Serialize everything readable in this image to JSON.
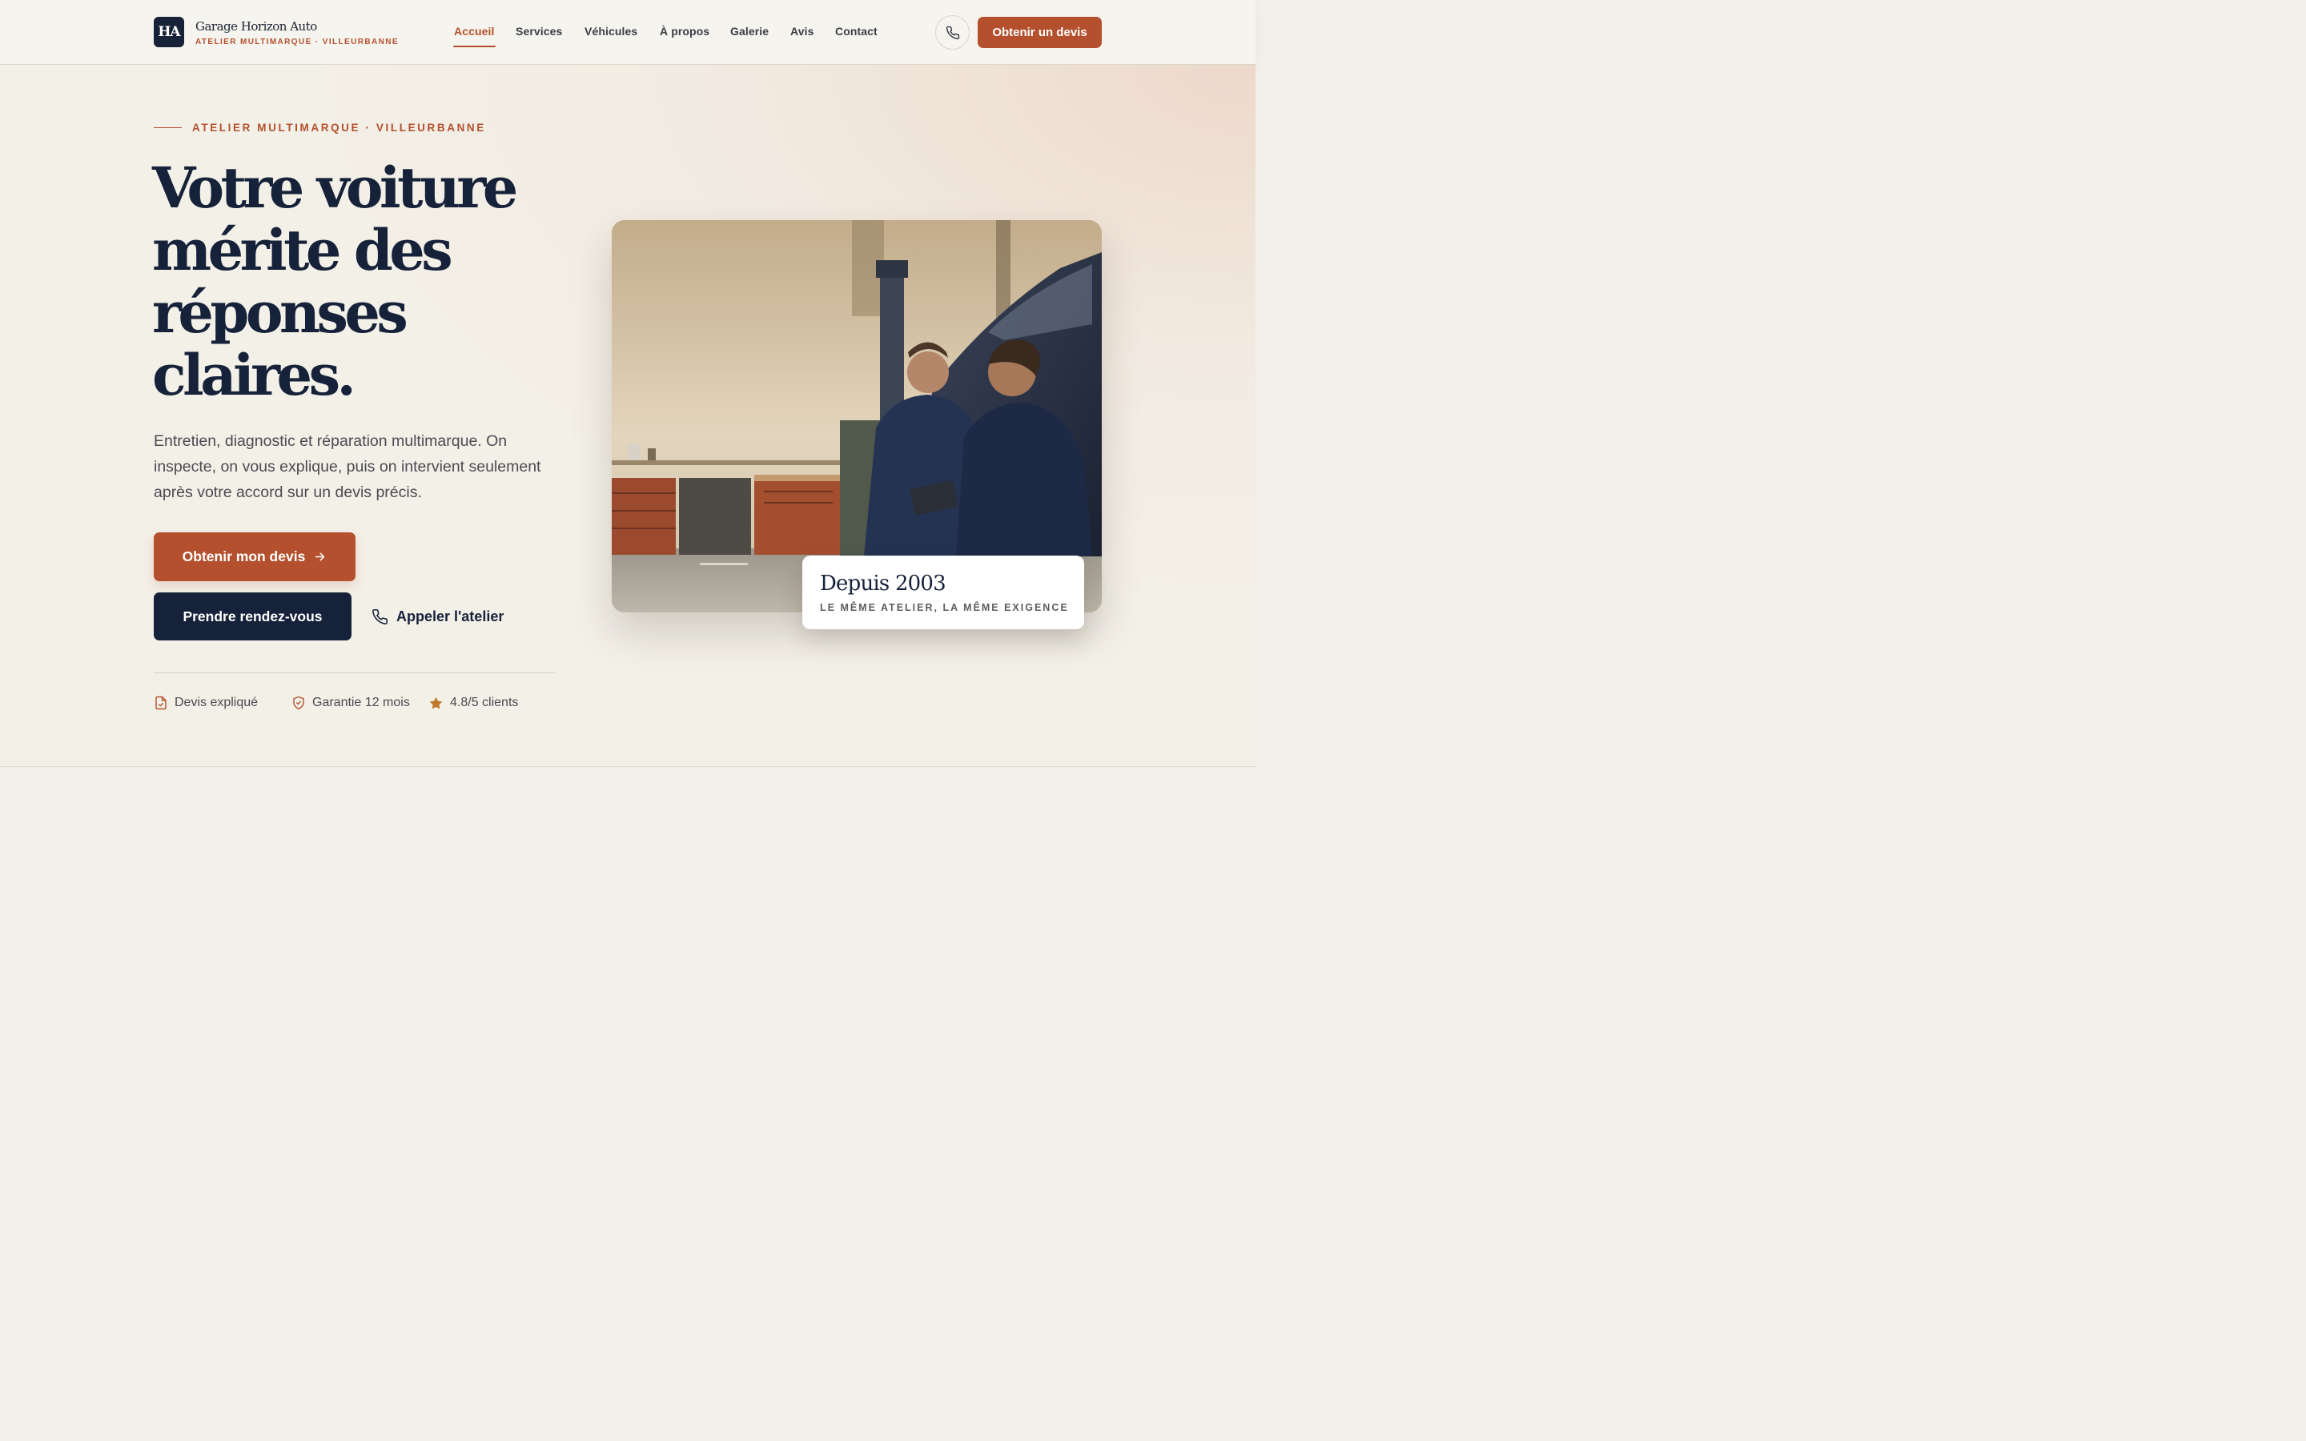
{
  "brand": {
    "logo_initials": "HA",
    "name": "Garage Horizon Auto",
    "tagline": "ATELIER MULTIMARQUE · VILLEURBANNE"
  },
  "nav": {
    "items": [
      {
        "label": "Accueil",
        "active": true
      },
      {
        "label": "Services",
        "active": false
      },
      {
        "label": "Véhicules",
        "active": false
      },
      {
        "label": "À propos",
        "active": false
      },
      {
        "label": "Galerie",
        "active": false
      },
      {
        "label": "Avis",
        "active": false
      },
      {
        "label": "Contact",
        "active": false
      }
    ],
    "phone_icon": "phone-icon",
    "cta_label": "Obtenir un devis"
  },
  "hero": {
    "eyebrow": "ATELIER MULTIMARQUE · VILLEURBANNE",
    "headline_lines": [
      "Votre voiture",
      "mérite des",
      "réponses",
      "claires."
    ],
    "lead": "Entretien, diagnostic et réparation multimarque. On inspecte, on vous explique, puis on intervient seulement après votre accord sur un devis précis.",
    "primary_button": "Obtenir mon devis",
    "secondary_button": "Prendre rendez-vous",
    "call_link": "Appeler l'atelier",
    "features": [
      {
        "icon": "document-icon",
        "label": "Devis expliqué"
      },
      {
        "icon": "shield-icon",
        "label": "Garantie 12 mois"
      },
      {
        "icon": "star-icon",
        "label": "4.8/5 clients"
      }
    ]
  },
  "photo_badge": {
    "title": "Depuis 2003",
    "subtitle": "LE MÊME ATELIER, LA MÊME EXIGENCE"
  },
  "colors": {
    "accent": "#b4502d",
    "navy": "#16223a",
    "background": "#f3f0e8"
  }
}
